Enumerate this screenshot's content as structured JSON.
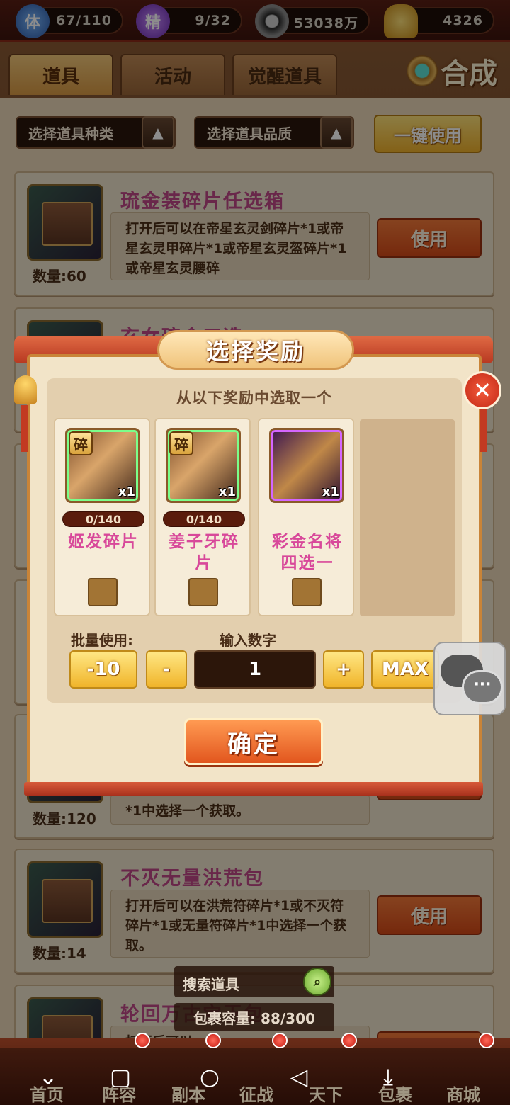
{
  "status_bar": {
    "stamina": {
      "icon": "体",
      "value": "67/110"
    },
    "spirit": {
      "icon": "精",
      "value": "9/32"
    },
    "coins": {
      "value": "53038万"
    },
    "gold": {
      "value": "4326"
    }
  },
  "tabs": [
    {
      "label": "道具",
      "active": true
    },
    {
      "label": "活动",
      "active": false
    },
    {
      "label": "觉醒道具",
      "active": false
    }
  ],
  "compose_label": "合成",
  "filters": {
    "type_label": "选择道具种类",
    "quality_label": "选择道具品质",
    "arrow": "▲",
    "use_all_label": "一键使用"
  },
  "items": [
    {
      "name": "琉金装碎片任选箱",
      "quantity": "数量:60",
      "desc": "打开后可以在帝星玄灵剑碎片*1或帝星玄灵甲碎片*1或帝星玄灵盔碎片*1或帝星玄灵腰碎",
      "use_label": "使用"
    },
    {
      "name": "玄女琉金三选",
      "quantity": "",
      "desc": "",
      "use_label": "使用"
    },
    {
      "name": "",
      "quantity": "数量:120",
      "desc": "*1中选择一个获取。",
      "use_label": "使用"
    },
    {
      "name": "不灭无量洪荒包",
      "quantity": "数量:14",
      "desc": "打开后可以在洪荒符碎片*1或不灭符碎片*1或无量符碎片*1中选择一个获取。",
      "use_label": "使用"
    },
    {
      "name": "轮回万古宝玉包",
      "quantity": "",
      "desc": "打开后可以",
      "use_label": "使用"
    }
  ],
  "dialog": {
    "title": "选择奖励",
    "subtitle": "从以下奖励中选取一个",
    "close_symbol": "✕",
    "rewards": [
      {
        "badge": "碎",
        "count": "x1",
        "progress": "0/140",
        "name": "姬发碎片"
      },
      {
        "badge": "碎",
        "count": "x1",
        "progress": "0/140",
        "name": "姜子牙碎片"
      },
      {
        "badge": "",
        "count": "x1",
        "progress": "",
        "name": "彩金名将四选一"
      }
    ],
    "batch_label": "批量使用:",
    "input_label": "输入数字",
    "minus10_label": "-10",
    "minus_label": "-",
    "quantity_value": "1",
    "plus_label": "+",
    "max_label": "MAX",
    "confirm_label": "确定"
  },
  "chat_dots": "···",
  "search": {
    "placeholder": "搜索道具",
    "icon": "search-icon"
  },
  "capacity": "包裹容量: 88/300",
  "game_nav": [
    "首页",
    "阵容",
    "副本",
    "征战",
    "天下",
    "包裹",
    "商城"
  ],
  "colors": {
    "accent": "#e2561e",
    "item_name": "#c04888",
    "reward_name": "#d8489a",
    "gold_button": "#f0b42a"
  }
}
